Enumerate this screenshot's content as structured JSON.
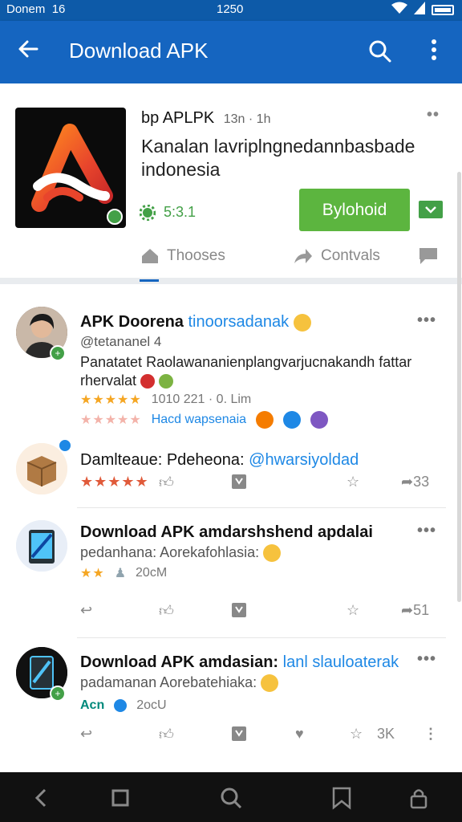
{
  "status_bar": {
    "carrier": "Donem",
    "signal": "16",
    "time": "1250"
  },
  "app_bar": {
    "title": "Download APK"
  },
  "app_card": {
    "developer": "bp APLPK",
    "time_meta": "13n · 1h",
    "title": "Kanalan lavriplngnedannbasbade indonesia",
    "rating_value": "5:3.1",
    "install_label": "Bylohoid",
    "tabs": [
      "Thooses",
      "Contvals"
    ]
  },
  "feed": [
    {
      "name": "APK Doorena",
      "name_link": "tinoorsadanak",
      "handle": "@tetananel 4",
      "text": "Panatatet Raolawananienplangvarjucnakandh fattar rhervalat",
      "meta1": "1010 221 · 0. Lim",
      "meta2_link": "Hacd wapsenaia"
    },
    {
      "name": "Damlteaue: Pdeheona:",
      "name_link": "@hwarsiyoldad",
      "share_count": "33"
    },
    {
      "name": "Download APK amdarshshend apdalai",
      "sub": "pedanhana: Aorekafohlasia:",
      "meta": "20cM",
      "share_count": "51"
    },
    {
      "name": "Download APK amdasian:",
      "name_link": "lanl slauloaterak",
      "sub": "padamanan Aorebatehiaka:",
      "meta_prefix": "Acn",
      "meta": "2ocU",
      "share_count": "3K"
    }
  ],
  "colors": {
    "primary": "#1565c0",
    "install": "#5cb53f",
    "link": "#1e88e5"
  }
}
